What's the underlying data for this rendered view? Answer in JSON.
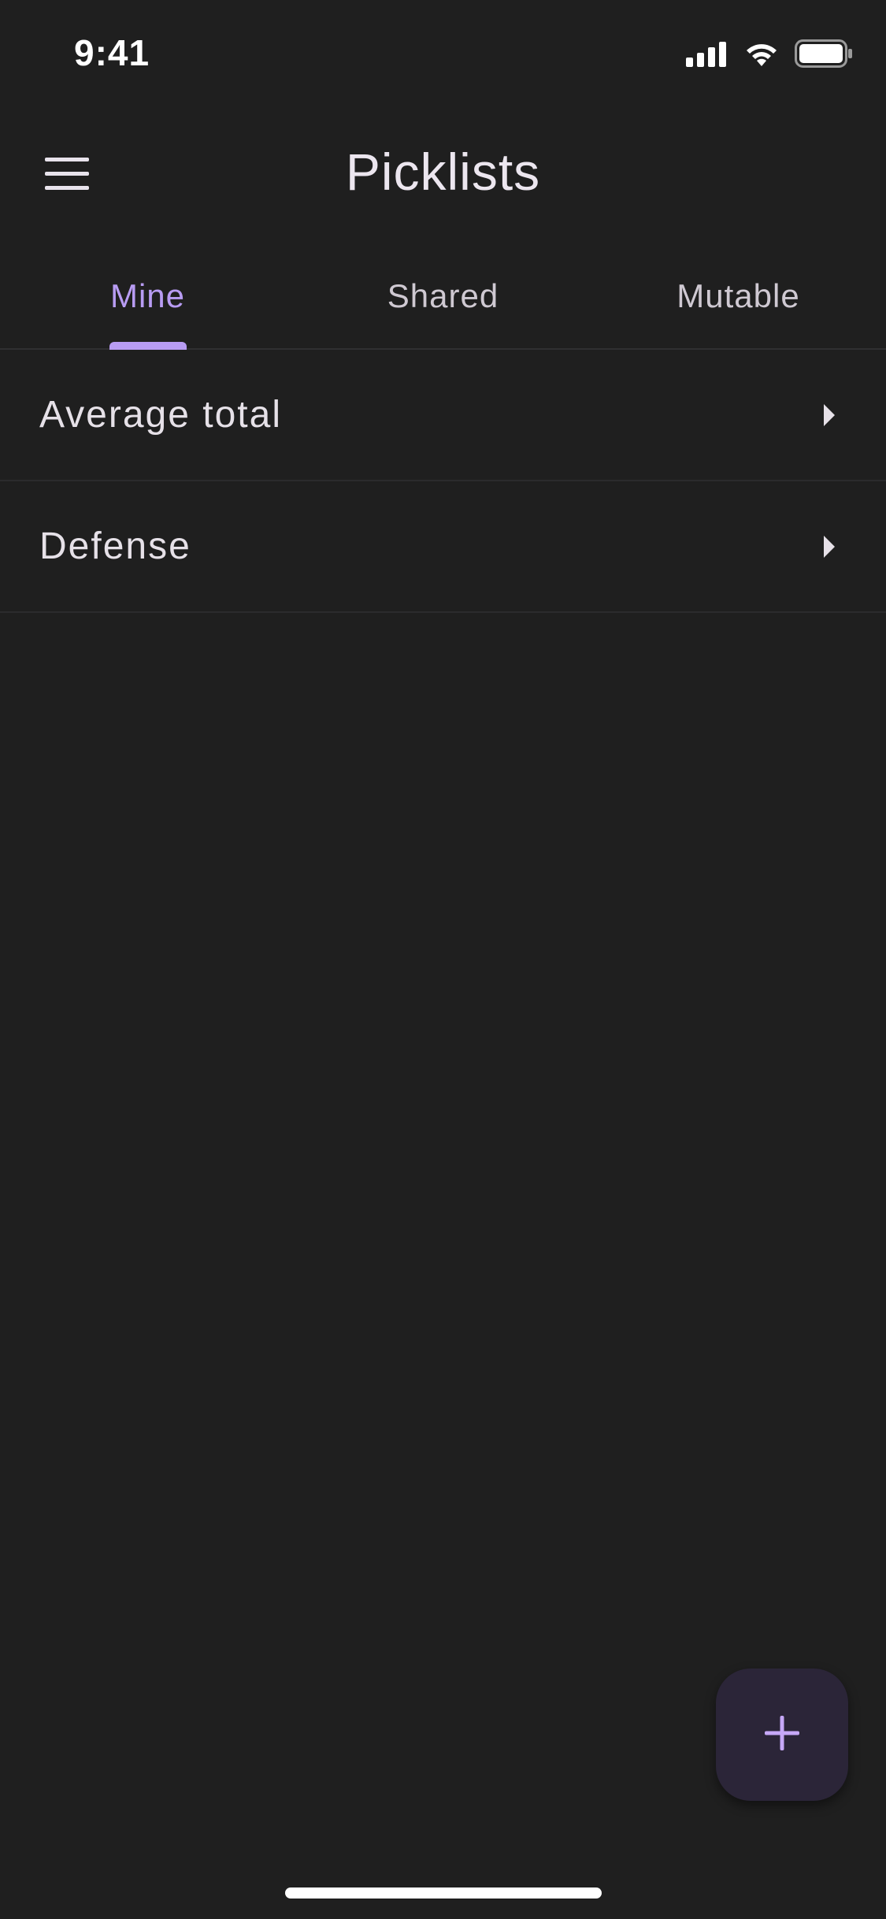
{
  "status_bar": {
    "time": "9:41",
    "icons": [
      "cellular-signal-icon",
      "wifi-icon",
      "battery-icon"
    ]
  },
  "app_bar": {
    "menu_icon": "hamburger-menu-icon",
    "title": "Picklists"
  },
  "tabs": [
    {
      "label": "Mine",
      "active": true
    },
    {
      "label": "Shared",
      "active": false
    },
    {
      "label": "Mutable",
      "active": false
    }
  ],
  "list": {
    "items": [
      {
        "label": "Average total",
        "icon": "chevron-right-icon"
      },
      {
        "label": "Defense",
        "icon": "chevron-right-icon"
      }
    ]
  },
  "fab": {
    "icon": "plus-icon"
  },
  "colors": {
    "background": "#1f1f1f",
    "accent": "#b89cf3",
    "fab_background": "#2b2538",
    "text": "#e6e1e8",
    "divider": "#2b2b2d"
  }
}
